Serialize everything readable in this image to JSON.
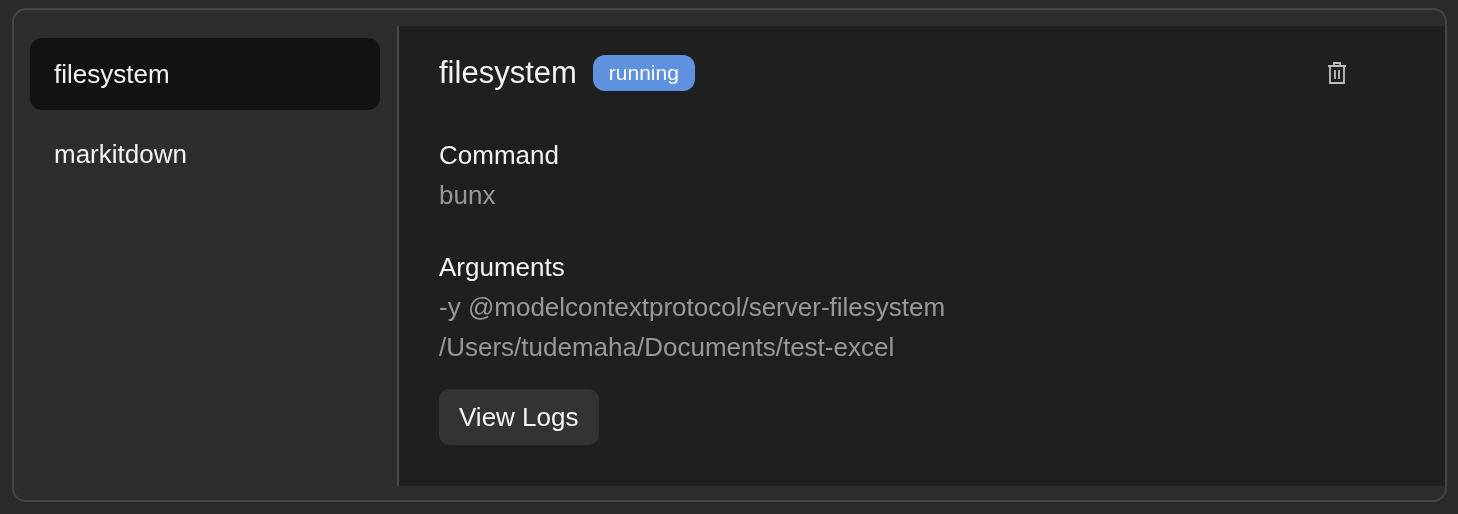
{
  "sidebar": {
    "items": [
      {
        "label": "filesystem",
        "selected": true
      },
      {
        "label": "markitdown",
        "selected": false
      }
    ]
  },
  "detail": {
    "title": "filesystem",
    "status": "running",
    "fields": [
      {
        "label": "Command",
        "lines": [
          "bunx"
        ]
      },
      {
        "label": "Arguments",
        "lines": [
          "-y @modelcontextprotocol/server-filesystem",
          "/Users/tudemaha/Documents/test-excel"
        ]
      }
    ],
    "button": "View Logs"
  }
}
